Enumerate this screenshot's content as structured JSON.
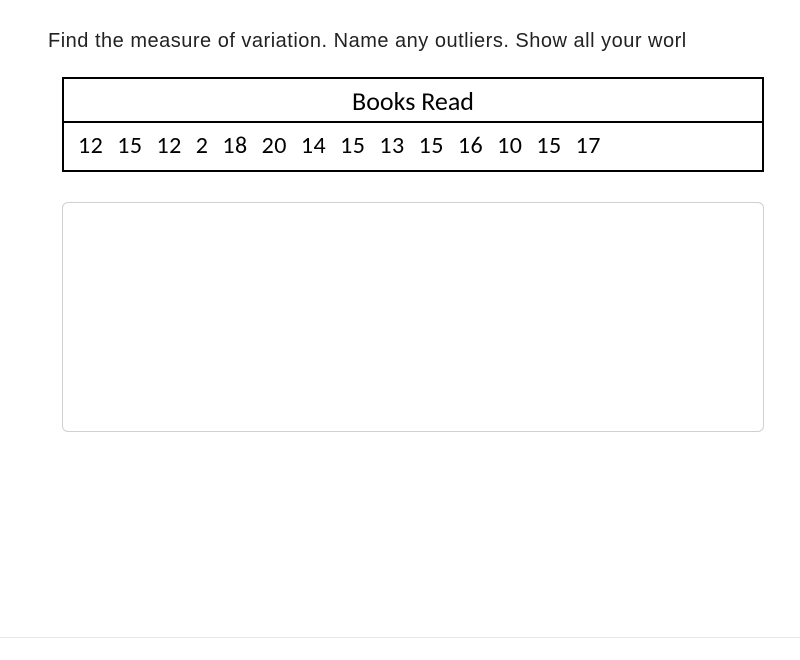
{
  "prompt": "Find the measure of variation. Name any outliers. Show all your worl",
  "table": {
    "title": "Books Read",
    "values_text": "12 15 12 2 18 20 14 15 13 15 16 10 15 17"
  },
  "chart_data": {
    "type": "table",
    "title": "Books Read",
    "values": [
      12,
      15,
      12,
      2,
      18,
      20,
      14,
      15,
      13,
      15,
      16,
      10,
      15,
      17
    ]
  },
  "work_area": {
    "value": ""
  }
}
